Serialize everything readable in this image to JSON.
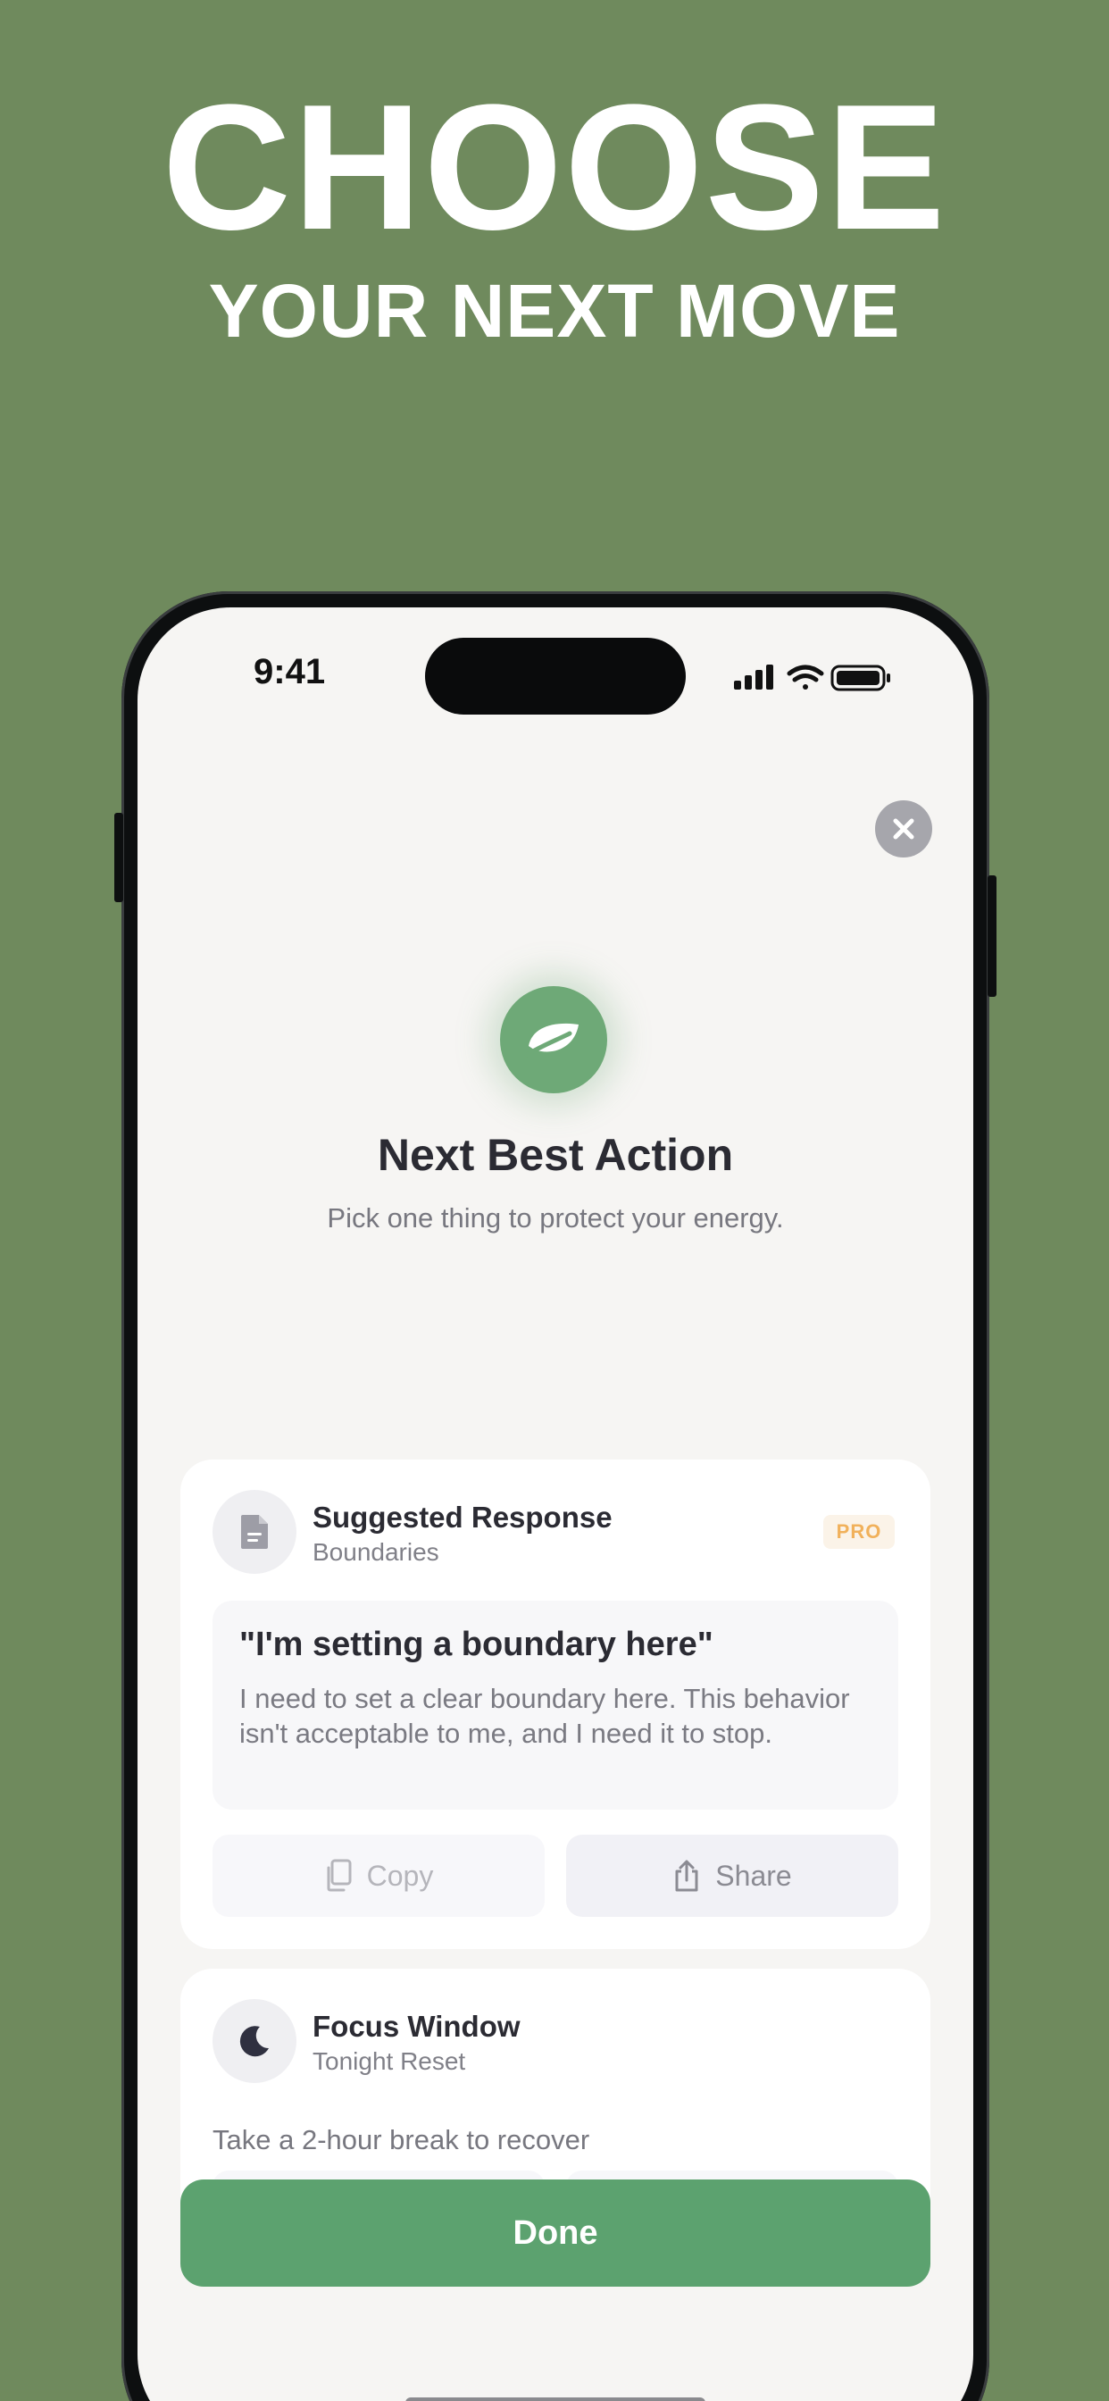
{
  "promo": {
    "headline": "CHOOSE",
    "subheadline": "YOUR NEXT MOVE"
  },
  "status_bar": {
    "time": "9:41",
    "icons": [
      "cellular-signal-icon",
      "wifi-icon",
      "battery-icon"
    ]
  },
  "sheet": {
    "close_icon": "close-icon",
    "badge_icon": "leaf-icon",
    "title": "Next Best Action",
    "subtitle": "Pick one thing to protect your energy."
  },
  "cards": [
    {
      "icon": "document-icon",
      "title": "Suggested Response",
      "subtitle": "Boundaries",
      "badge": "PRO",
      "quote_title": "\"I'm setting a boundary here\"",
      "quote_body": "I need to set a clear boundary here. This behavior isn't acceptable to me, and I need it to stop.",
      "copy_label": "Copy",
      "share_label": "Share"
    },
    {
      "icon": "moon-icon",
      "title": "Focus Window",
      "subtitle": "Tonight Reset",
      "body": "Take a 2-hour break to recover"
    }
  ],
  "done_label": "Done",
  "colors": {
    "background": "#6f8a5d",
    "accent_green": "#5ca26f",
    "pro_badge": "#f1b15b"
  }
}
